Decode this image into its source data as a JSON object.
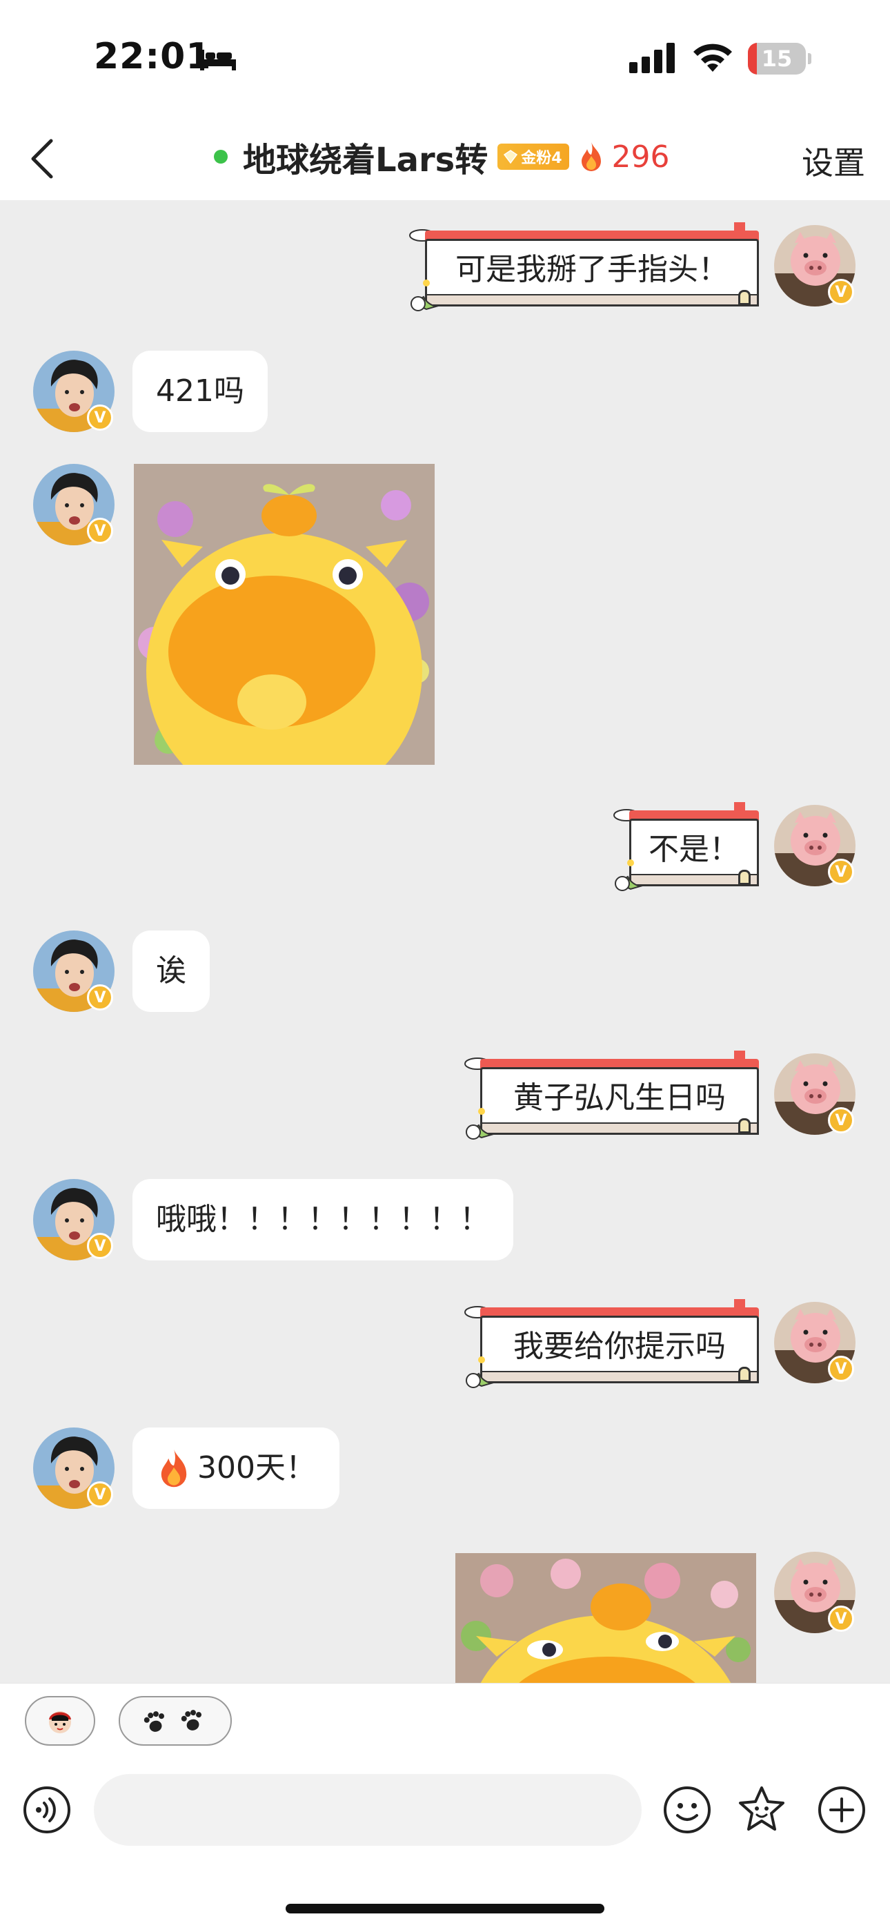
{
  "status_bar": {
    "time": "22:01",
    "battery_percent": 15,
    "battery_label": "15",
    "icons": [
      "bed-icon",
      "cellular-signal-icon",
      "wifi-icon",
      "battery-icon"
    ]
  },
  "nav": {
    "back_icon": "chevron-left-icon",
    "online": true,
    "title": "地球绕着Lars转",
    "fan_badge": "金粉4",
    "streak_icon": "fire-icon",
    "streak_count": "296",
    "settings_label": "设置"
  },
  "messages": [
    {
      "side": "right",
      "type": "text",
      "text": "可是我掰了手指头！"
    },
    {
      "side": "left",
      "type": "text",
      "text": "421吗"
    },
    {
      "side": "left",
      "type": "sticker",
      "sticker": "yellow-creature-sticker"
    },
    {
      "side": "right",
      "type": "text",
      "text": "不是！"
    },
    {
      "side": "left",
      "type": "text",
      "text": "诶"
    },
    {
      "side": "right",
      "type": "text",
      "text": "黄子弘凡生日吗"
    },
    {
      "side": "left",
      "type": "text",
      "text": "哦哦！！！！！！！！！"
    },
    {
      "side": "right",
      "type": "text",
      "text": "我要给你提示吗"
    },
    {
      "side": "left",
      "type": "text",
      "fire_icon": "fire-icon",
      "text": "300天！"
    },
    {
      "side": "right",
      "type": "sticker",
      "sticker": "yellow-creature-sticker"
    }
  ],
  "avatars": {
    "left": "boy-avatar",
    "right": "pig-avatar",
    "verified_badge": "V"
  },
  "quick_bar": {
    "chips": [
      "cartoon-face-icon",
      "paw-prints-icon"
    ]
  },
  "input_bar": {
    "voice_icon": "voice-icon",
    "placeholder": "",
    "emoji_icon": "emoji-icon",
    "sticker_icon": "star-face-icon",
    "plus_icon": "plus-circle-icon"
  },
  "colors": {
    "chat_bg": "#ededed",
    "accent_red": "#e8403a",
    "online_green": "#3cc24a",
    "badge_gold": "#f5b82e"
  }
}
